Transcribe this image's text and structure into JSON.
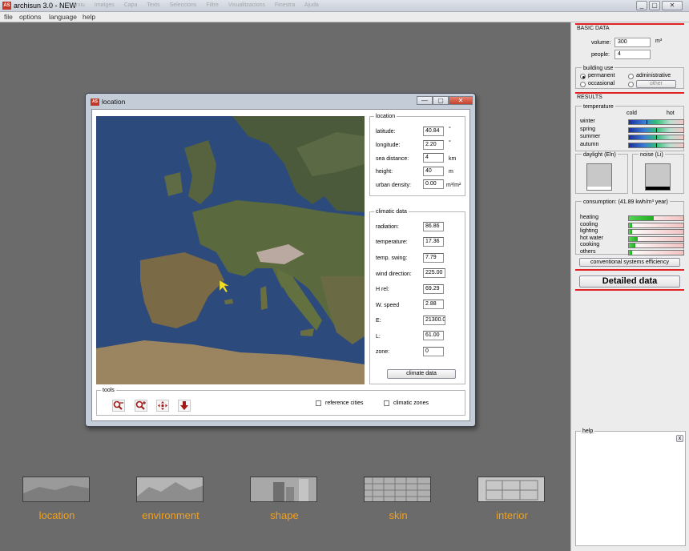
{
  "app": {
    "title": "archisun 3.0 - NEW",
    "ghost_menu": "Arxiu Imatges Capa Texts Seleccions Filtre Visualitzacions Finestra Ajuda",
    "window_buttons": [
      "_",
      "▢",
      "✕"
    ]
  },
  "menu": [
    "file",
    "options",
    "language",
    "help"
  ],
  "dialog": {
    "title": "location",
    "buttons": [
      "—",
      "▢",
      "✕"
    ],
    "location": {
      "legend": "location",
      "fields": [
        {
          "label": "latitude:",
          "value": "40.84",
          "unit": "°"
        },
        {
          "label": "longitude:",
          "value": "2.20",
          "unit": "°"
        },
        {
          "label": "sea distance:",
          "value": "4",
          "unit": "km"
        },
        {
          "label": "height:",
          "value": "40",
          "unit": "m"
        },
        {
          "label": "urban density:",
          "value": "0.00",
          "unit": "m³/m²"
        }
      ]
    },
    "climatic": {
      "legend": "climatic data",
      "fields": [
        {
          "label": "radiation:",
          "value": "86.86"
        },
        {
          "label": "temperature:",
          "value": "17.36"
        },
        {
          "label": "temp. swing:",
          "value": "7.79"
        },
        {
          "label": "wind direction:",
          "value": "225.00"
        },
        {
          "label": "H rel:",
          "value": "69.29"
        },
        {
          "label": "W. speed",
          "value": "2.88"
        },
        {
          "label": "E:",
          "value": "21300.0"
        },
        {
          "label": "L:",
          "value": "61.00"
        },
        {
          "label": "zone:",
          "value": "0"
        }
      ],
      "button": "climate data"
    },
    "tools": {
      "legend": "tools",
      "reference_cities": "reference cities",
      "climatic_zones": "climatic zones"
    }
  },
  "basic_data": {
    "heading": "BASIC DATA",
    "volume_label": "volume:",
    "volume_value": "300",
    "volume_unit": "m³",
    "people_label": "people:",
    "people_value": "4",
    "building_use": {
      "legend": "building use",
      "permanent": "permanent",
      "occasional": "occasional",
      "administrative": "administrative",
      "other": "other"
    }
  },
  "results": {
    "heading": "RESULTS",
    "temperature": {
      "legend": "temperature",
      "cold": "cold",
      "hot": "hot",
      "rows": [
        {
          "label": "winter",
          "value": 0.33
        },
        {
          "label": "spring",
          "value": 0.5
        },
        {
          "label": "summer",
          "value": 0.5
        },
        {
          "label": "autumn",
          "value": 0.5
        }
      ]
    },
    "daylight": "daylight (Eln)",
    "daylight_level": 0.12,
    "noise": "noise (Li)",
    "noise_level": 0.14,
    "consumption": {
      "legend": "consumption: (41.89 kwh/m³ year)",
      "rows": [
        {
          "label": "heating",
          "fill": 0.45
        },
        {
          "label": "cooling",
          "fill": 0.06
        },
        {
          "label": "lighting",
          "fill": 0.06
        },
        {
          "label": "hot water",
          "fill": 0.16
        },
        {
          "label": "cooking",
          "fill": 0.12
        },
        {
          "label": "others",
          "fill": 0.06
        }
      ]
    },
    "efficiency_button": "conventional systems efficiency",
    "detailed_button": "Detailed data"
  },
  "help": {
    "legend": "help",
    "close": "x"
  },
  "bottom_nav": [
    {
      "label": "location"
    },
    {
      "label": "environment"
    },
    {
      "label": "shape"
    },
    {
      "label": "skin"
    },
    {
      "label": "interior"
    }
  ]
}
